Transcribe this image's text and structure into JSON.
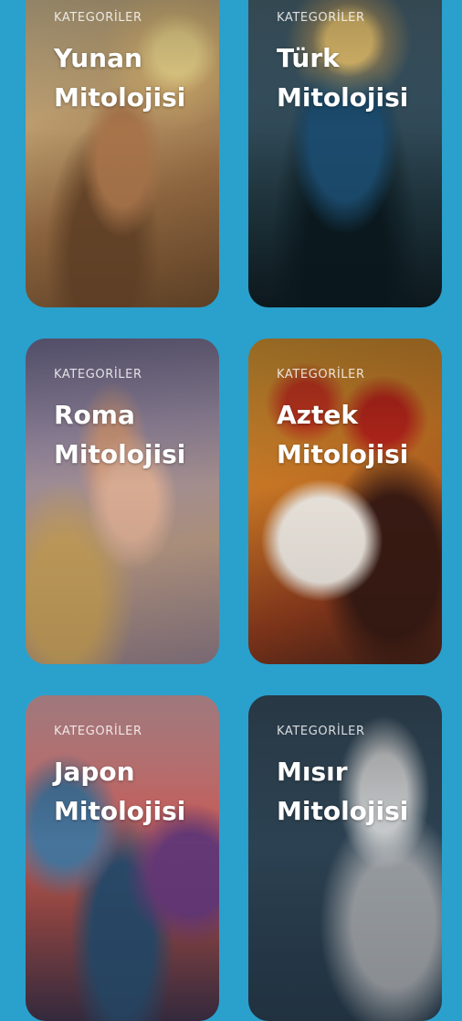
{
  "screen": {
    "background": "#2aa0cd"
  },
  "cards": [
    {
      "kicker": "KATEGORİLER",
      "title_line1": "Yunan",
      "title_line2": "Mitolojisi"
    },
    {
      "kicker": "KATEGORİLER",
      "title_line1": "Türk",
      "title_line2": "Mitolojisi"
    },
    {
      "kicker": "KATEGORİLER",
      "title_line1": "Roma",
      "title_line2": "Mitolojisi"
    },
    {
      "kicker": "KATEGORİLER",
      "title_line1": "Aztek",
      "title_line2": "Mitolojisi"
    },
    {
      "kicker": "KATEGORİLER",
      "title_line1": "Japon",
      "title_line2": "Mitolojisi"
    },
    {
      "kicker": "KATEGORİLER",
      "title_line1": "Mısır",
      "title_line2": "Mitolojisi"
    }
  ]
}
